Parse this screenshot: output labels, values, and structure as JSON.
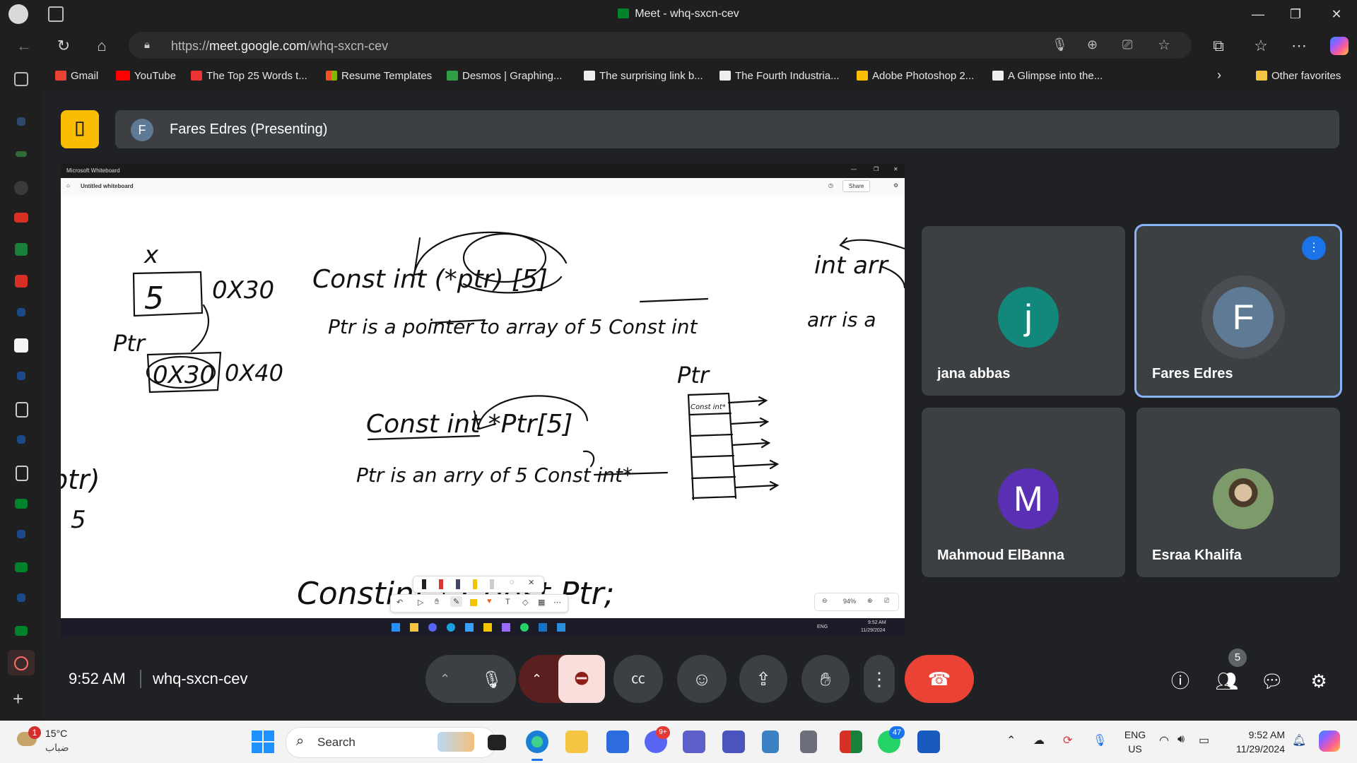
{
  "browser": {
    "window_title": "Meet - whq-sxcn-cev",
    "url_prefix": "https://",
    "url_host": "meet.google.com",
    "url_path": "/whq-sxcn-cev",
    "favorites": [
      {
        "label": "Gmail",
        "color": "#ea4335"
      },
      {
        "label": "YouTube",
        "color": "#ff0000"
      },
      {
        "label": "The Top 25 Words t...",
        "color": "#d33"
      },
      {
        "label": "Resume Templates",
        "color": "#f25022"
      },
      {
        "label": "Desmos | Graphing...",
        "color": "#2f9e44"
      },
      {
        "label": "The surprising link b...",
        "color": "#ffffff"
      },
      {
        "label": "The Fourth Industria...",
        "color": "#ffffff"
      },
      {
        "label": "Adobe Photoshop 2...",
        "color": "#fbbc04"
      },
      {
        "label": "A Glimpse into the...",
        "color": "#ffffff"
      }
    ],
    "other_favorites": "Other favorites"
  },
  "meet": {
    "logo_text": "⌷",
    "presenter_initial": "F",
    "presenter_label": "Fares Edres (Presenting)",
    "time": "9:52 AM",
    "meeting_code": "whq-sxcn-cev",
    "participant_count": "5",
    "participants": [
      {
        "name": "jana abbas",
        "initial": "j",
        "color": "#12887a"
      },
      {
        "name": "Fares Edres",
        "initial": "F",
        "color": "#5f7a94"
      },
      {
        "name": "Mahmoud ElBanna",
        "initial": "M",
        "color": "#5b2fb3"
      },
      {
        "name": "Esraa Khalifa",
        "initial": "",
        "color": "#6b8a5e"
      }
    ]
  },
  "shared_screen": {
    "app_title": "Microsoft Whiteboard",
    "doc_title": "Untitled whiteboard",
    "share_label": "Share",
    "zoom": "94%",
    "mini_time": "9:52 AM",
    "mini_date": "11/29/2024",
    "mini_lang": "ENG",
    "handwriting": {
      "box_value": "5",
      "addr1": "0X30",
      "var_x": "x",
      "ptr_label": "Ptr",
      "addr2": "0X30",
      "addr3": "0X40",
      "decl1": "Const int (*ptr) [5]",
      "note1": "Ptr is a pointer to array of 5 Const int",
      "decl2": "Const int *Ptr[5]",
      "note2": "Ptr is an arry of 5 Const int*",
      "ptr_right": "Ptr",
      "cell_text": "Const int*",
      "decl3": "Constint * Const Ptr;",
      "right_decl": "int arr",
      "right_note": "arr is a",
      "left_frag1": "ptr)",
      "left_frag2": "5"
    }
  },
  "taskbar": {
    "weather_temp": "15°C",
    "weather_desc": "ضباب",
    "weather_badge": "1",
    "search_placeholder": "Search",
    "lang_top": "ENG",
    "lang_bottom": "US",
    "time": "9:52 AM",
    "date": "11/29/2024",
    "badge_discord": "9+",
    "badge_whatsapp": "47"
  }
}
